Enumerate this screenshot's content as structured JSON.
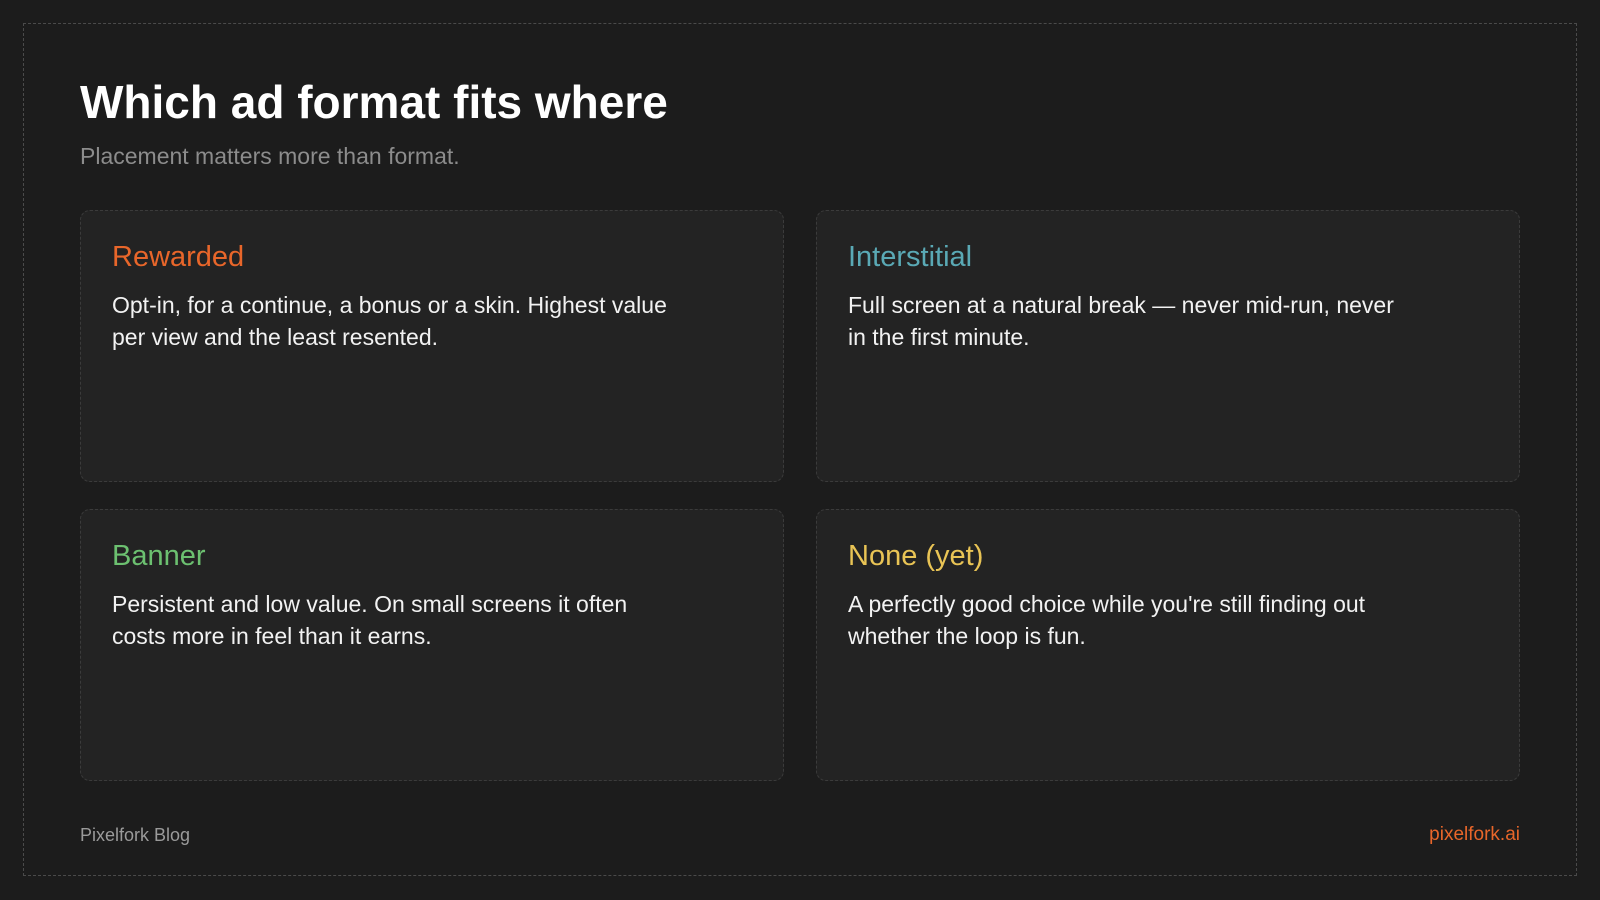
{
  "header": {
    "title": "Which ad format fits where",
    "subtitle": "Placement matters more than format."
  },
  "cards": [
    {
      "title": "Rewarded",
      "body": "Opt-in, for a continue, a bonus or a skin. Highest value per view and the least resented.",
      "color": "#e8662a"
    },
    {
      "title": "Interstitial",
      "body": "Full screen at a natural break — never mid-run, never in the first minute.",
      "color": "#5aa9b5"
    },
    {
      "title": "Banner",
      "body": "Persistent and low value. On small screens it often costs more in feel than it earns.",
      "color": "#6cc070"
    },
    {
      "title": "None (yet)",
      "body": "A perfectly good choice while you're still finding out whether the loop is fun.",
      "color": "#e9c455"
    }
  ],
  "footer": {
    "brand": "Pixelfork Blog",
    "url": "pixelfork.ai"
  },
  "colors": {
    "background": "#1c1c1c",
    "card_background": "#232323",
    "accent": "#e8662a"
  }
}
